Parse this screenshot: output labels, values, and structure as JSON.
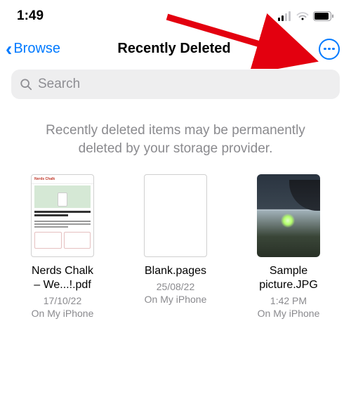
{
  "status": {
    "time": "1:49"
  },
  "nav": {
    "back_label": "Browse",
    "title": "Recently Deleted"
  },
  "search": {
    "placeholder": "Search"
  },
  "message": "Recently deleted items may be permanently deleted by your storage provider.",
  "files": [
    {
      "name": "Nerds Chalk\n– We...!.pdf",
      "date": "17/10/22",
      "location": "On My iPhone"
    },
    {
      "name": "Blank.pages",
      "date": "25/08/22",
      "location": "On My iPhone"
    },
    {
      "name": "Sample\npicture.JPG",
      "date": "1:42 PM",
      "location": "On My iPhone"
    }
  ],
  "colors": {
    "accent": "#007AFF",
    "muted": "#8A8A8E"
  }
}
